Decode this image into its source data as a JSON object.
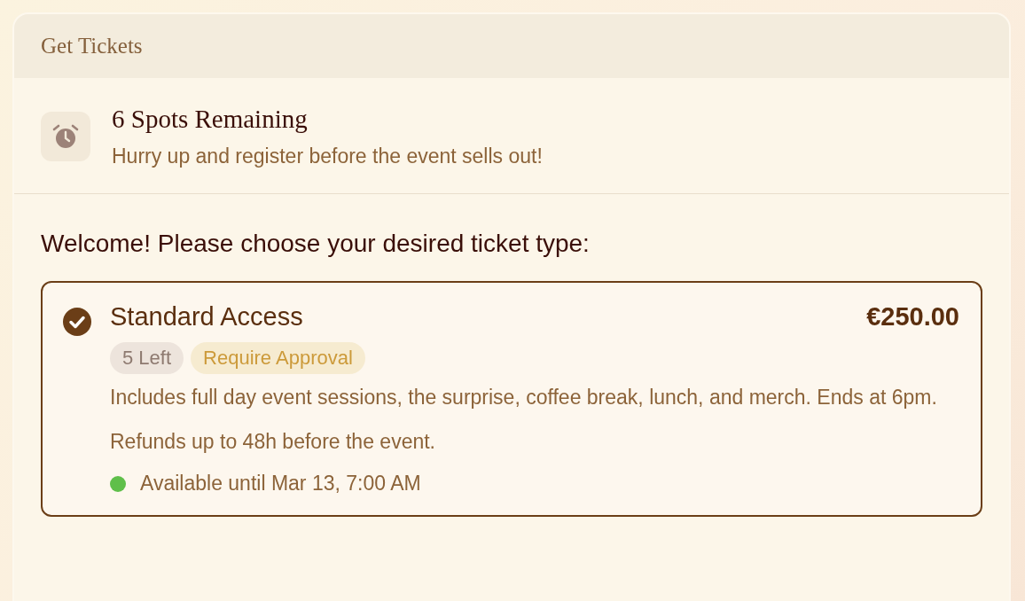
{
  "panel": {
    "title": "Get Tickets"
  },
  "availability": {
    "title": "6 Spots Remaining",
    "message": "Hurry up and register before the event sells out!"
  },
  "prompt": "Welcome! Please choose your desired ticket type:",
  "tickets": [
    {
      "name": "Standard Access",
      "price": "€250.00",
      "selected": true,
      "badges": [
        {
          "label": "5 Left",
          "kind": "count"
        },
        {
          "label": "Require Approval",
          "kind": "warning"
        }
      ],
      "description": "Includes full day event sessions, the surprise, coffee break, lunch, and merch. Ends at 6pm.",
      "refund": "Refunds up to 48h before the event.",
      "availability": {
        "label": "Available until Mar 13, 7:00 AM",
        "color": "#5fbf4a"
      }
    }
  ]
}
